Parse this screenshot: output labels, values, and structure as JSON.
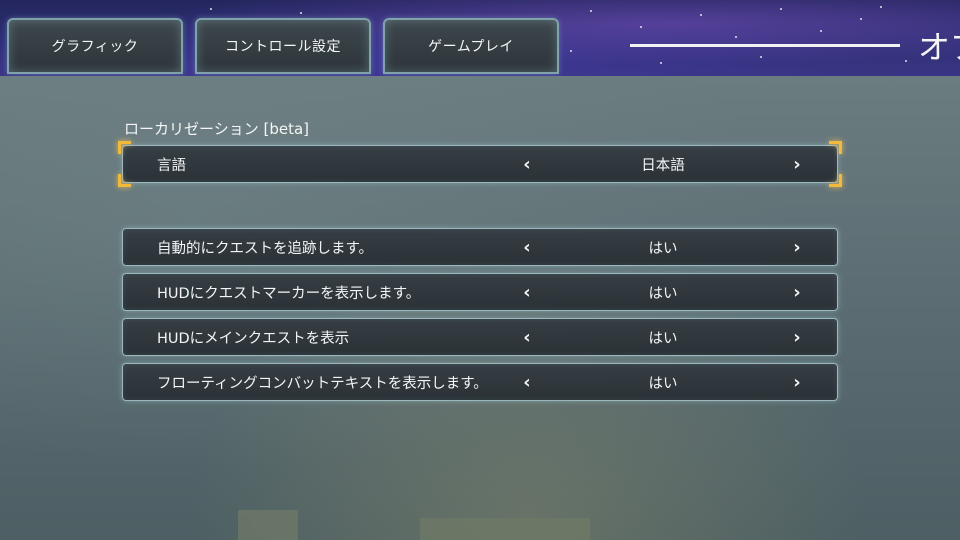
{
  "tabs": [
    {
      "label": "グラフィック"
    },
    {
      "label": "コントロール設定"
    },
    {
      "label": "ゲームプレイ"
    }
  ],
  "header": {
    "title": "オプ"
  },
  "localization": {
    "section_label": "ローカリゼーション [beta]",
    "language": {
      "label": "言語",
      "value": "日本語"
    }
  },
  "gameplay_options": [
    {
      "label": "自動的にクエストを追跡します。",
      "value": "はい"
    },
    {
      "label": "HUDにクエストマーカーを表示します。",
      "value": "はい"
    },
    {
      "label": "HUDにメインクエストを表示",
      "value": "はい"
    },
    {
      "label": "フローティングコンバットテキストを表示します。",
      "value": "はい"
    }
  ],
  "icons": {
    "prev": "chevron-left-icon",
    "next": "chevron-right-icon"
  },
  "colors": {
    "focus_accent": "#f3b93a",
    "row_border": "#9db7bd",
    "tab_border": "#7fa2ab"
  }
}
